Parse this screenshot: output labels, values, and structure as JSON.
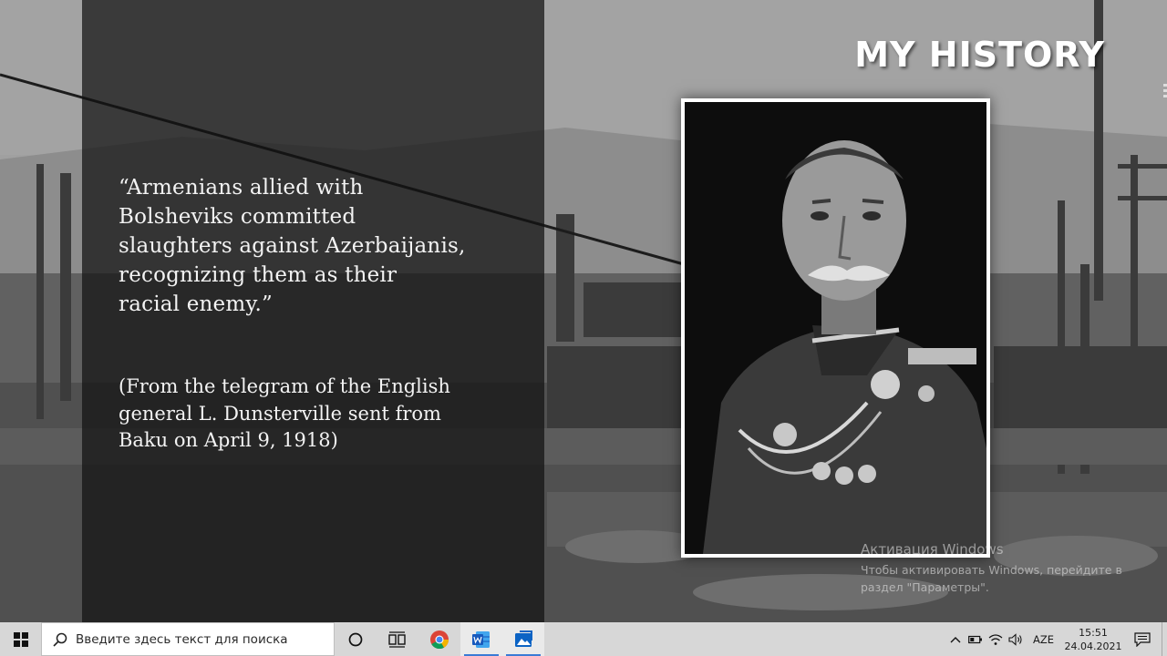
{
  "slide": {
    "title": "MY HISTORY",
    "quote": "“Armenians allied with\nBolsheviks committed\nslaughters against Azerbaijanis,\nrecognizing them as their\nracial enemy.”",
    "source": "(From the telegram of the English\ngeneral L. Dunsterville sent from\nBaku on April 9, 1918)"
  },
  "watermark": {
    "title": "Активация Windows",
    "subtitle": "Чтобы активировать Windows, перейдите в\nраздел \"Параметры\"."
  },
  "taskbar": {
    "search_placeholder": "Введите здесь текст для поиска",
    "apps": [
      "cortana-icon",
      "task-view-icon",
      "chrome-icon",
      "word-icon",
      "photos-icon"
    ],
    "language": "AZE",
    "time": "15:51",
    "date": "24.04.2021"
  },
  "colors": {
    "taskbar_bg": "#d7d7d7",
    "panel_overlay": "#121212",
    "text_light": "#f3f3f3",
    "accent": "#3a7bd5"
  }
}
